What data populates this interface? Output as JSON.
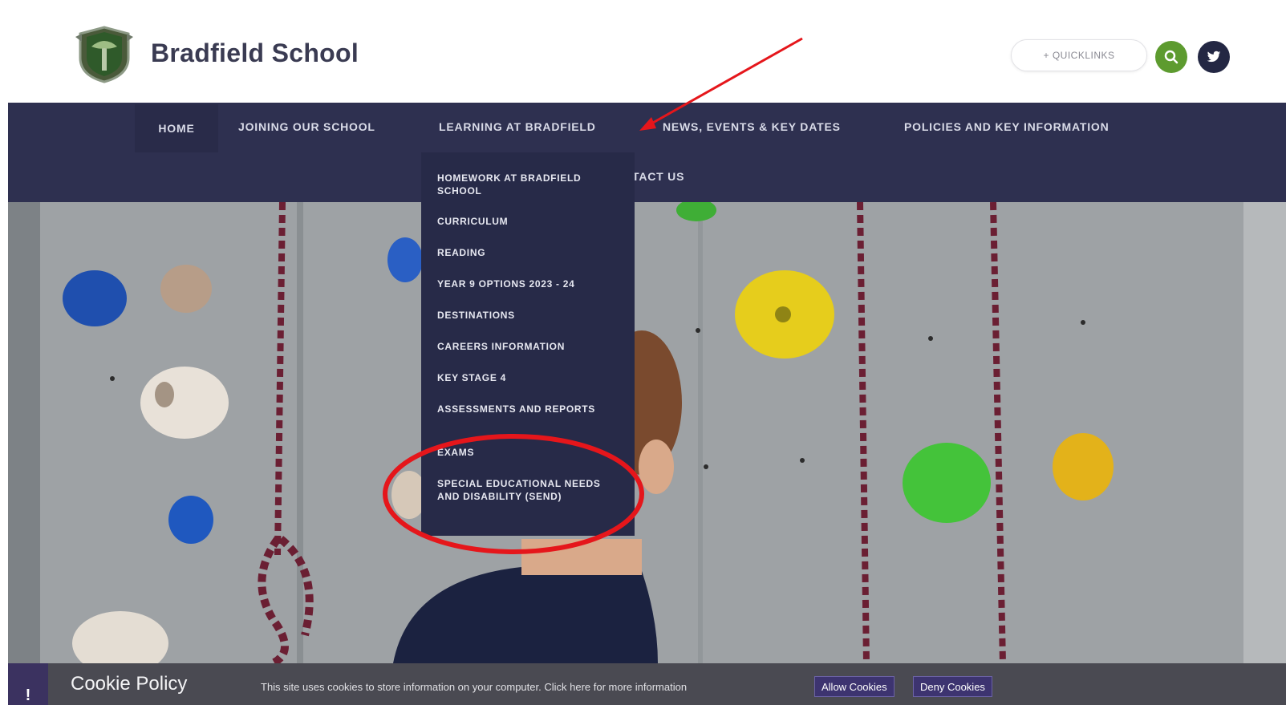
{
  "header": {
    "brand": "Bradfield School",
    "quicklinks_label": "+ QUICKLINKS"
  },
  "nav": {
    "items": [
      "HOME",
      "JOINING OUR SCHOOL",
      "LEARNING AT BRADFIELD",
      "NEWS, EVENTS & KEY DATES",
      "POLICIES AND KEY INFORMATION"
    ],
    "second_row": "CONTACT US",
    "second_row_visible": "TACT US"
  },
  "dropdown": {
    "items": [
      "HOMEWORK AT BRADFIELD SCHOOL",
      "CURRICULUM",
      "READING",
      "YEAR 9 OPTIONS 2023 - 24",
      "DESTINATIONS",
      "CAREERS INFORMATION",
      "KEY STAGE 4",
      "ASSESSMENTS AND REPORTS",
      "EXAMS",
      "SPECIAL EDUCATIONAL NEEDS AND DISABILITY (SEND)"
    ]
  },
  "cookie": {
    "title": "Cookie Policy",
    "text": "This site uses cookies to store information on your computer. Click here for more information",
    "allow": "Allow Cookies",
    "deny": "Deny Cookies",
    "corner_icon": "info-icon"
  },
  "colors": {
    "nav_bg": "#2e3050",
    "dropdown_bg": "#272a48",
    "search_green": "#5d9b2f",
    "annotation_red": "#e5161b"
  }
}
